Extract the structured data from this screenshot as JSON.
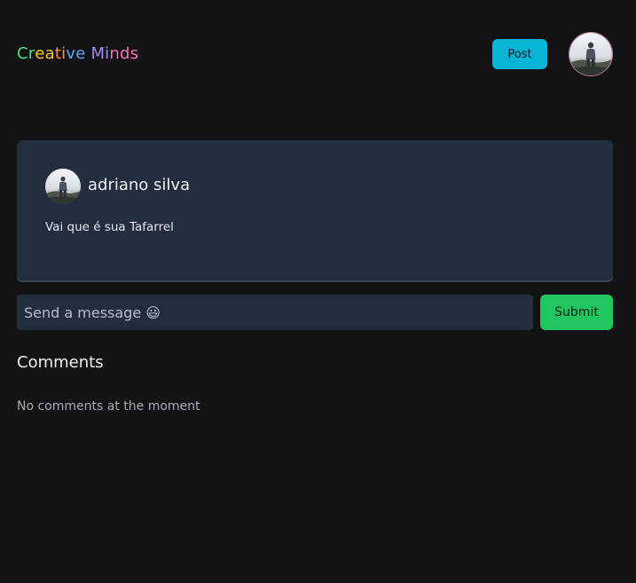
{
  "header": {
    "logo_text": "Creative Minds",
    "logo_colors": [
      "#4ade80",
      "#facc15",
      "#fb923c",
      "#60a5fa",
      "#a78bfa",
      "#f472b6"
    ],
    "post_button_label": "Post",
    "avatar_icon": "user-avatar"
  },
  "post": {
    "author_name": "adriano silva",
    "content": "Vai que é sua Tafarrel",
    "avatar_icon": "user-avatar"
  },
  "comment_form": {
    "input_placeholder": "Send a message 😃",
    "input_value": "",
    "submit_label": "Submit"
  },
  "comments": {
    "heading": "Comments",
    "empty_text": "No comments at the moment"
  },
  "colors": {
    "background": "#131316",
    "card": "#222d40",
    "post_button": "#06b6d4",
    "submit_button": "#22c55e"
  }
}
